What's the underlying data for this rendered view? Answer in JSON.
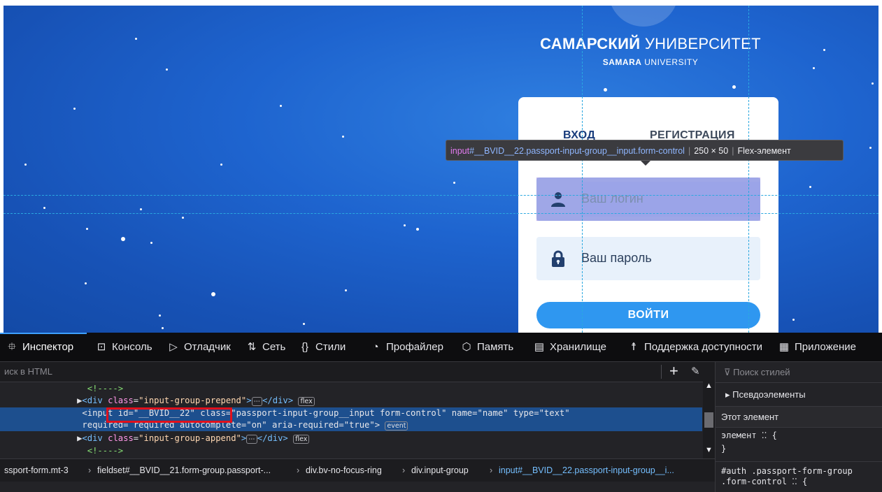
{
  "page": {
    "brand_bold": "САМАРСКИЙ",
    "brand_light": "УНИВЕРСИТЕТ",
    "brand_sub_bold": "SAMARA",
    "brand_sub_light": "UNIVERSITY",
    "tab_login": "ВХОД",
    "tab_register": "РЕГИСТРАЦИЯ",
    "login_placeholder": "Ваш логин",
    "password_placeholder": "Ваш пароль",
    "submit_label": "ВОЙТИ"
  },
  "tooltip": {
    "tag": "input",
    "selector": "#__BVID__22.passport-input-group__input.form-control",
    "size": "250 × 50",
    "kind": "Flex-элемент"
  },
  "devtools": {
    "tabs": [
      {
        "icon": "inspector-icon",
        "label": "Инспектор",
        "active": true
      },
      {
        "icon": "console-icon",
        "label": "Консоль"
      },
      {
        "icon": "debugger-icon",
        "label": "Отладчик"
      },
      {
        "icon": "network-icon",
        "label": "Сеть"
      },
      {
        "icon": "style-editor-icon",
        "label": "Стили"
      },
      {
        "icon": "profiler-icon",
        "label": "Профайлер"
      },
      {
        "icon": "memory-icon",
        "label": "Память"
      },
      {
        "icon": "storage-icon",
        "label": "Хранилище"
      },
      {
        "icon": "accessibility-icon",
        "label": "Поддержка доступности"
      },
      {
        "icon": "application-icon",
        "label": "Приложение"
      }
    ],
    "html_search_placeholder": "иск в HTML",
    "markup": {
      "comment1": "<!---->",
      "prepend_tag": "div",
      "prepend_attr": "class",
      "prepend_val": "\"input-group-prepend\"",
      "flex_badge": "flex",
      "input_tag_open": "input",
      "input_id_attr": "id",
      "input_id_val": "\"__BVID__22\"",
      "input_class_attr": "class",
      "input_class_val": "\"passport-input-group__input form-control\"",
      "input_name_attr": "name",
      "input_name_val": "\"name\"",
      "input_type_attr": "type",
      "input_type_val": "\"text\"",
      "input_required_attr": "required",
      "input_required_val": "required",
      "input_autocomplete_attr": "autocomplete",
      "input_autocomplete_val": "\"on\"",
      "input_aria_attr": "aria-required",
      "input_aria_val": "\"true\"",
      "event_badge": "event",
      "append_tag": "div",
      "append_attr": "class",
      "append_val": "\"input-group-append\"",
      "comment2": "<!---->"
    },
    "breadcrumbs": [
      "ssport-form.mt-3",
      "fieldset#__BVID__21.form-group.passport-...",
      "div.bv-no-focus-ring",
      "div.input-group",
      "input#__BVID__22.passport-input-group__i..."
    ],
    "rules": {
      "filter_placeholder": "Поиск стилей",
      "pseudo_elements": "Псевдоэлементы",
      "this_element": "Этот элемент",
      "element_rule": "элемент ⁚⁚ {",
      "close_brace": "}",
      "selector_line1": "#auth .passport-form-group",
      "selector_line2": ".form-control ⁚⁚ {"
    }
  }
}
